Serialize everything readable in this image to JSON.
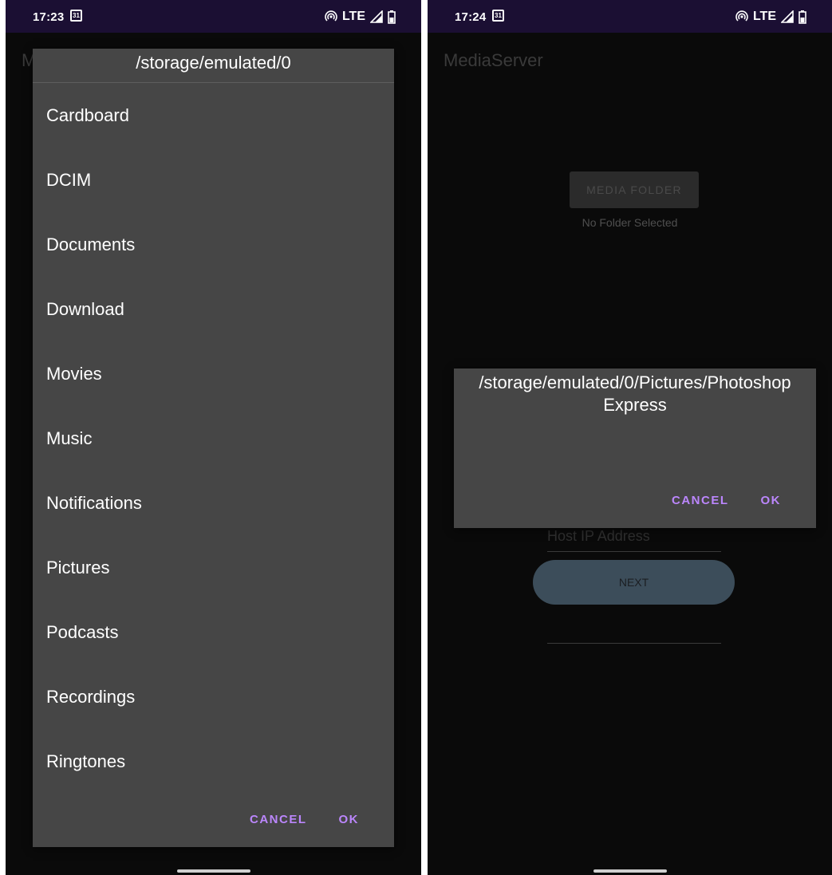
{
  "left_screen": {
    "status_bar": {
      "time": "17:23",
      "calendar_day": "31",
      "network": "LTE"
    },
    "app_title": "MediaServer",
    "dialog": {
      "title": "/storage/emulated/0",
      "folders": [
        "Cardboard",
        "DCIM",
        "Documents",
        "Download",
        "Movies",
        "Music",
        "Notifications",
        "Pictures",
        "Podcasts",
        "Recordings",
        "Ringtones"
      ],
      "cancel_label": "CANCEL",
      "ok_label": "OK"
    }
  },
  "right_screen": {
    "status_bar": {
      "time": "17:24",
      "calendar_day": "31",
      "network": "LTE"
    },
    "app_title": "MediaServer",
    "media_folder_button": "MEDIA FOLDER",
    "folder_status": "No Folder Selected",
    "host_ip_placeholder": "Host IP Address",
    "next_button": "NEXT",
    "dialog": {
      "title": "/storage/emulated/0/Pictures/Photoshop Express",
      "cancel_label": "CANCEL",
      "ok_label": "OK"
    }
  },
  "colors": {
    "status_bar_bg": "#1b0f33",
    "screen_bg": "#0a0a0a",
    "dialog_bg": "#464646",
    "accent": "#bb86fc",
    "next_button_bg": "#3c4d5a"
  },
  "icons": [
    "calendar-icon",
    "hotspot-icon",
    "signal-icon",
    "battery-icon"
  ]
}
